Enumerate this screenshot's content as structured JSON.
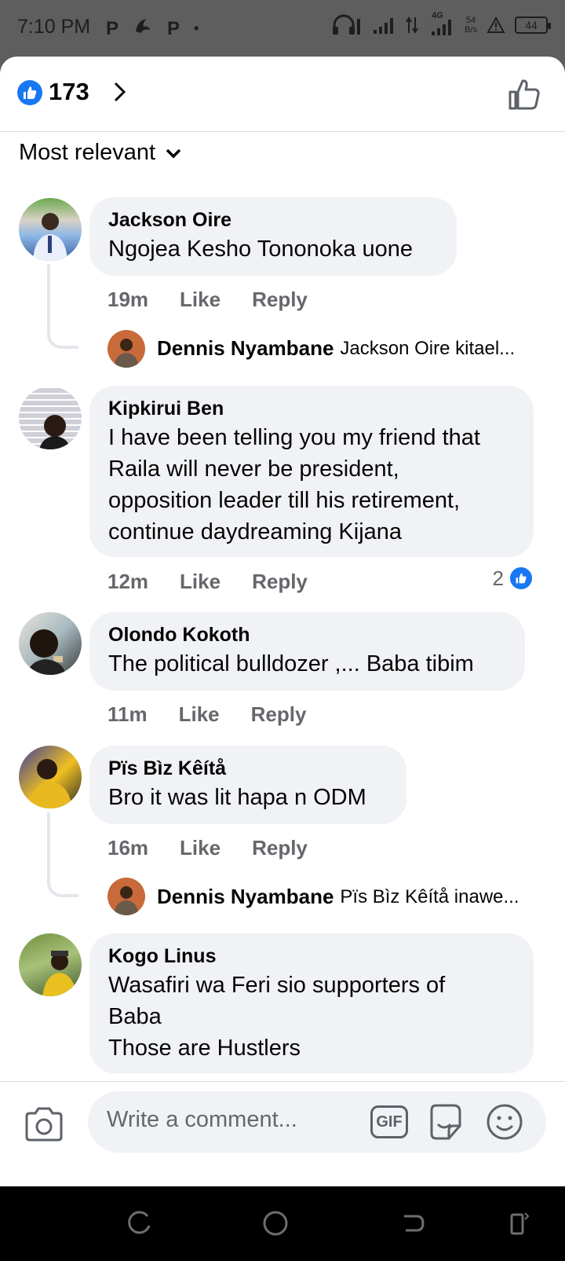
{
  "status_bar": {
    "time": "7:10 PM",
    "left_icons": [
      "P",
      "P",
      "•"
    ],
    "network_label": "4G",
    "speed_value": "54",
    "speed_unit": "B/s",
    "battery": "44"
  },
  "header": {
    "reaction_count": "173"
  },
  "sort": {
    "label": "Most relevant"
  },
  "comments": [
    {
      "name": "Jackson Oire",
      "text": "Ngojea Kesho Tononoka uone",
      "time": "19m",
      "like": "Like",
      "reply": "Reply",
      "reply_preview": {
        "name": "Dennis Nyambane",
        "text": "Jackson Oire kitael..."
      }
    },
    {
      "name": "Kipkirui Ben",
      "lines": [
        "I have been telling you my friend that",
        "Raila will never be president,",
        "opposition leader till his retirement,",
        "continue daydreaming Kijana"
      ],
      "time": "12m",
      "like": "Like",
      "reply": "Reply",
      "likes": "2"
    },
    {
      "name": "Olondo Kokoth",
      "text": "The political bulldozer ,... Baba tibim",
      "time": "11m",
      "like": "Like",
      "reply": "Reply"
    },
    {
      "name": "Pïs Bìz Kêítå",
      "text": "Bro it was lit hapa n ODM",
      "time": "16m",
      "like": "Like",
      "reply": "Reply",
      "reply_preview": {
        "name": "Dennis Nyambane",
        "text": "Pïs Bìz Kêítå inawe..."
      }
    },
    {
      "name": "Kogo Linus",
      "lines": [
        "Wasafiri wa Feri sio supporters of",
        "Baba",
        "Those are Hustlers"
      ]
    }
  ],
  "composer": {
    "placeholder": "Write a comment...",
    "gif_label": "GIF"
  },
  "colors": {
    "brand_blue": "#1877f2",
    "bubble_bg": "#f0f2f5",
    "secondary_text": "#65676b"
  }
}
